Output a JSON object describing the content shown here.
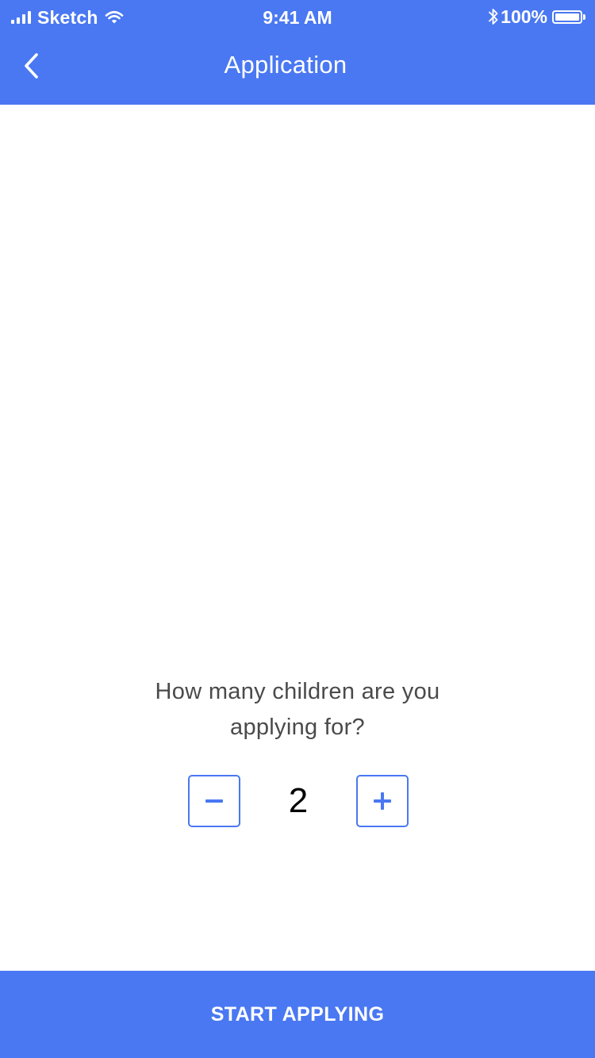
{
  "status_bar": {
    "carrier": "Sketch",
    "time": "9:41 AM",
    "battery_percent": "100%",
    "battery_level": 1.0
  },
  "header": {
    "title": "Application",
    "back_icon": "chevron-left-icon"
  },
  "question": {
    "line1": "How many children are you",
    "line2": "applying for?"
  },
  "stepper": {
    "value": "2",
    "decrement_icon": "minus-icon",
    "increment_icon": "plus-icon"
  },
  "cta": {
    "label": "START APPLYING"
  },
  "colors": {
    "primary": "#4a78f2",
    "text": "#4a4a4a",
    "background": "#ffffff"
  }
}
